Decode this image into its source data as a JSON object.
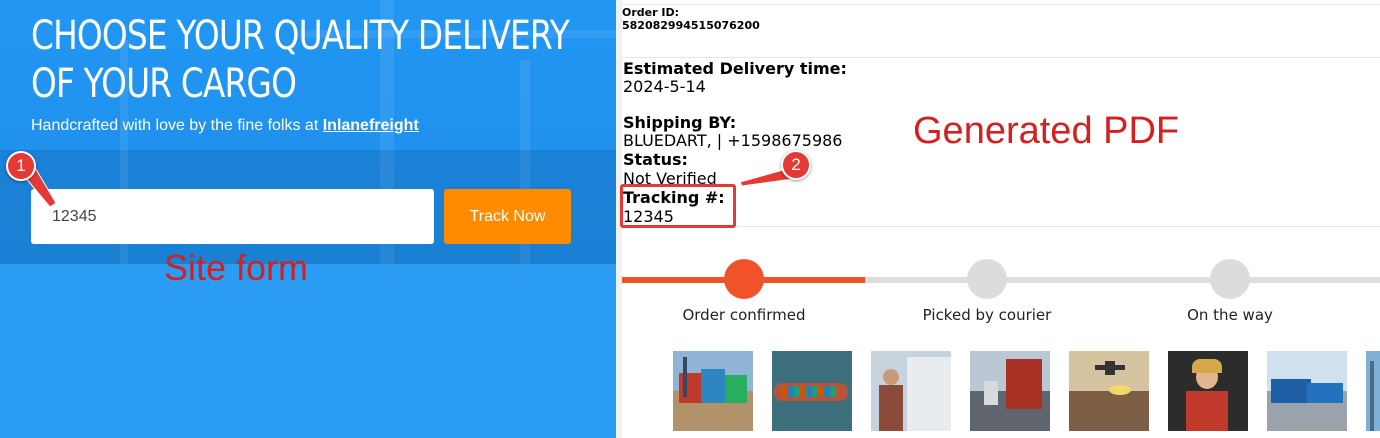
{
  "site": {
    "headline_line1": "CHOOSE YOUR QUALITY DELIVERY",
    "headline_line2": "OF YOUR CARGO",
    "subline_prefix": "Handcrafted with love by the fine folks at ",
    "subline_link": "Inlanefreight",
    "tracking_input_value": "12345",
    "track_button": "Track Now",
    "annotation_label": "Site form",
    "badge_1": "1"
  },
  "pdf": {
    "order_id_label": "Order ID:",
    "order_id_value": "582082994515076200",
    "est_delivery_label": "Estimated Delivery time:",
    "est_delivery_value": "2024-5-14",
    "shipping_label": "Shipping BY:",
    "shipping_value": "BLUEDART, | +1598675986",
    "status_label": "Status:",
    "status_value": "Not Verified",
    "tracking_label": "Tracking #:",
    "tracking_value": "12345",
    "annotation_label": "Generated PDF",
    "badge_2": "2",
    "progress": {
      "steps": [
        {
          "label": "Order confirmed",
          "done": true
        },
        {
          "label": "Picked by courier",
          "done": false
        },
        {
          "label": "On the way",
          "done": false
        }
      ]
    },
    "thumbnails": [
      "container-port",
      "cargo-ship",
      "truck-driver",
      "red-truck-highway",
      "plane-over-containers",
      "woman-driver",
      "blue-trucks-lot",
      "partial-image"
    ]
  },
  "colors": {
    "site_blue": "#2a9cf2",
    "track_button": "#ff8c00",
    "annotation_red": "#d42020",
    "progress_done": "#f0532a",
    "progress_todo": "#dedede"
  }
}
